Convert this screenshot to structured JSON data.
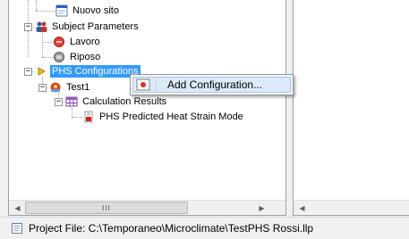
{
  "tree": {
    "nuovo_sito": "Nuovo sito",
    "subject_parameters": "Subject Parameters",
    "lavoro": "Lavoro",
    "riposo": "Riposo",
    "phs_configurations": "PHS Configurations",
    "test1": "Test1",
    "calculation_results": "Calculation Results",
    "phs_model": "PHS Predicted Heat Strain Mode",
    "expander_collapse": "−"
  },
  "context_menu": {
    "add_configuration": "Add Configuration..."
  },
  "scrollbar": {
    "left_arrow": "◀",
    "right_arrow": "▶",
    "thumb_grip": "III"
  },
  "statusbar": {
    "project_file": "Project File: C:\\Temporaneo\\Microclimate\\TestPHS Rossi.llp"
  },
  "colors": {
    "selection": "#3399ff",
    "menu_highlight": "#dbe9f8"
  },
  "icons": {
    "nuovo_sito": "site-document-icon",
    "subject_parameters": "people-icon",
    "lavoro": "red-circle-icon",
    "riposo": "gray-circle-icon",
    "phs_configurations": "yellow-arrow-icon",
    "test1": "test-config-icon",
    "calculation_results": "results-grid-icon",
    "phs_model": "chart-document-icon",
    "add_configuration": "add-config-icon",
    "status_file": "document-icon"
  }
}
